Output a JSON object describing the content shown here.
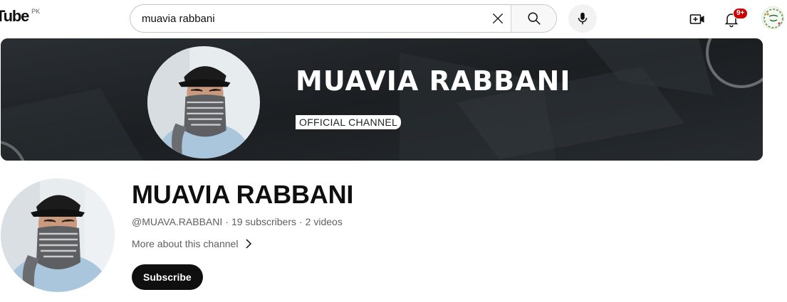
{
  "header": {
    "logo_text": "Tube",
    "region": "PK",
    "search": {
      "value": "muavia rabbani",
      "placeholder": "Search"
    },
    "notification_count": "9+",
    "icons": {
      "clear": "close-icon",
      "search": "search-icon",
      "mic": "mic-icon",
      "create": "video-add-icon",
      "notifications": "bell-icon",
      "account": "account-avatar"
    }
  },
  "banner": {
    "title": "MUAVIA RABBANI",
    "tagline": "OFFICIAL CHANNEL"
  },
  "channel": {
    "name": "MUAVIA RABBANI",
    "handle": "@MUAVA.RABBANI",
    "subscribers": "19 subscribers",
    "videos": "2 videos",
    "separator": "·",
    "more_about": "More about this channel",
    "subscribe_label": "Subscribe"
  },
  "colors": {
    "banner_bg": "#1d2125",
    "badge_red": "#cc0000",
    "subscribe_bg": "#0f0f0f",
    "meta_text": "#606060"
  }
}
